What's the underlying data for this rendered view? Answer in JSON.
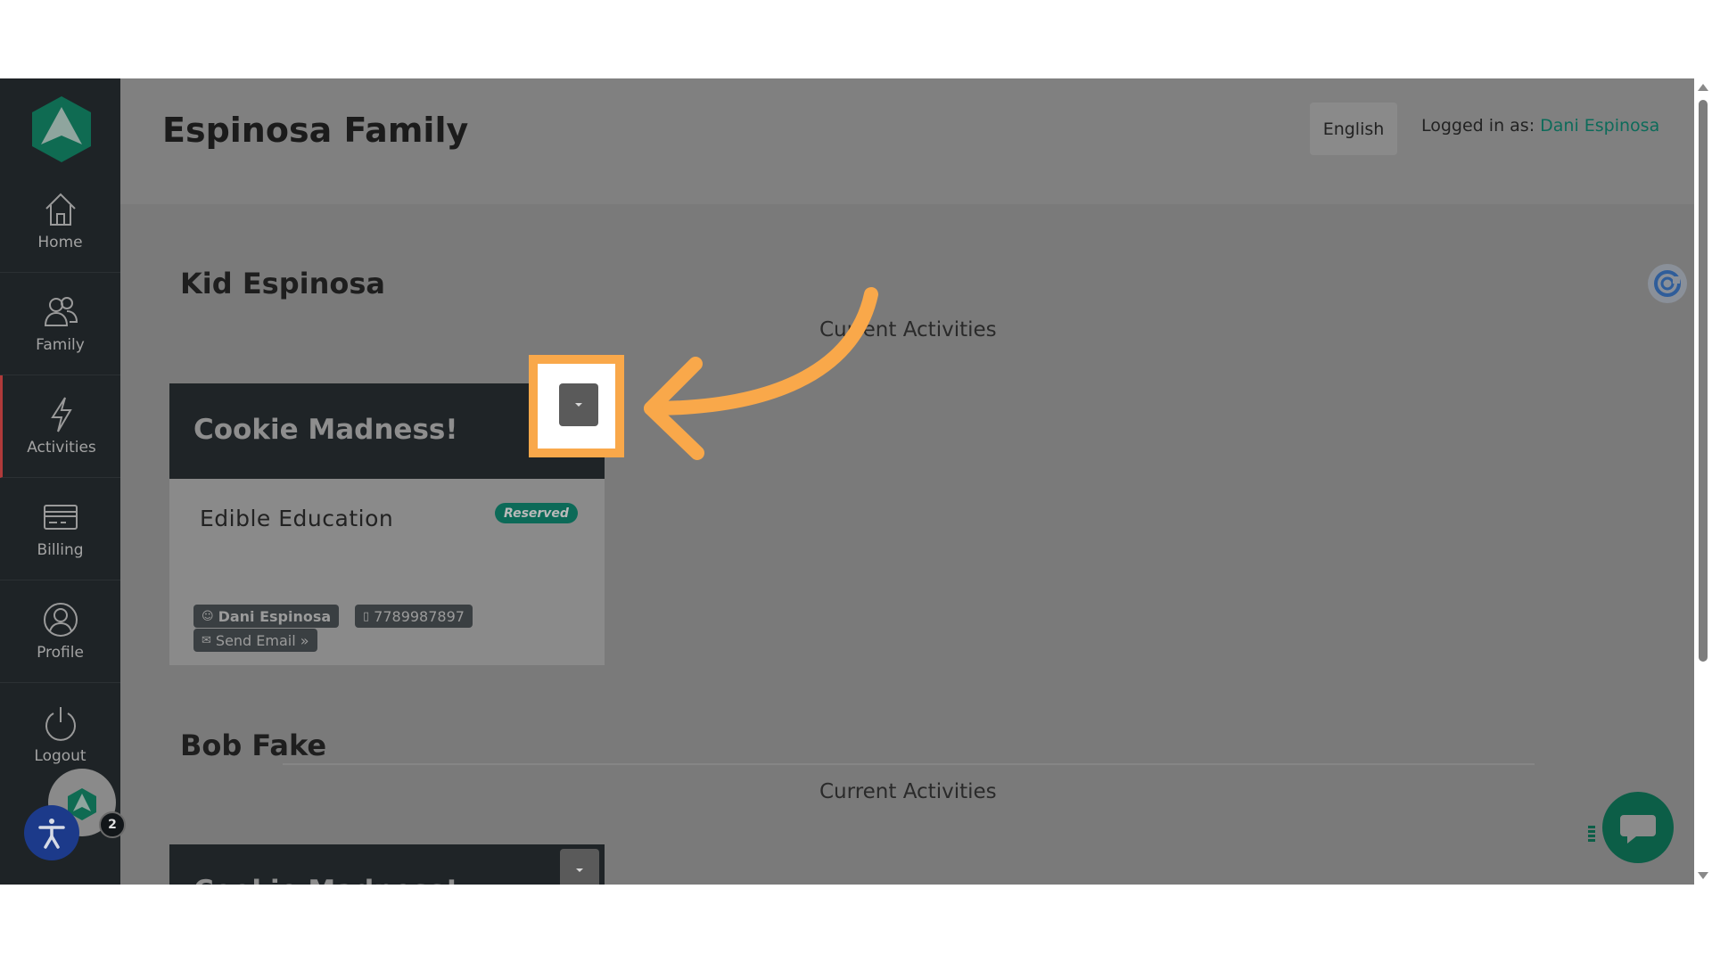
{
  "header": {
    "family_title": "Espinosa Family",
    "language_button": "English",
    "logged_in_label": "Logged in as:",
    "logged_in_user": "Dani Espinosa"
  },
  "sidebar": {
    "items": [
      {
        "label": "Home",
        "icon": "home-icon"
      },
      {
        "label": "Family",
        "icon": "family-icon"
      },
      {
        "label": "Activities",
        "icon": "activities-icon",
        "active": true
      },
      {
        "label": "Billing",
        "icon": "billing-icon"
      },
      {
        "label": "Profile",
        "icon": "profile-icon"
      },
      {
        "label": "Logout",
        "icon": "logout-icon"
      }
    ]
  },
  "kids": [
    {
      "name": "Kid Espinosa",
      "section_label": "Current Activities",
      "activity": {
        "title": "Cookie Madness!",
        "provider": "Edible Education",
        "status_badge": "Reserved",
        "contact_name": "Dani Espinosa",
        "contact_phone": "7789987897",
        "send_email_label": "Send Email »"
      }
    },
    {
      "name": "Bob Fake",
      "section_label": "Current Activities",
      "activity": {
        "title": "Cookie Madness!"
      }
    }
  ],
  "notifications": {
    "count": "2"
  },
  "colors": {
    "accent": "#0d6b5a",
    "sidebar_bg": "#1e2326",
    "highlight": "#f9a84a",
    "badge_bg": "#0c6a58"
  }
}
